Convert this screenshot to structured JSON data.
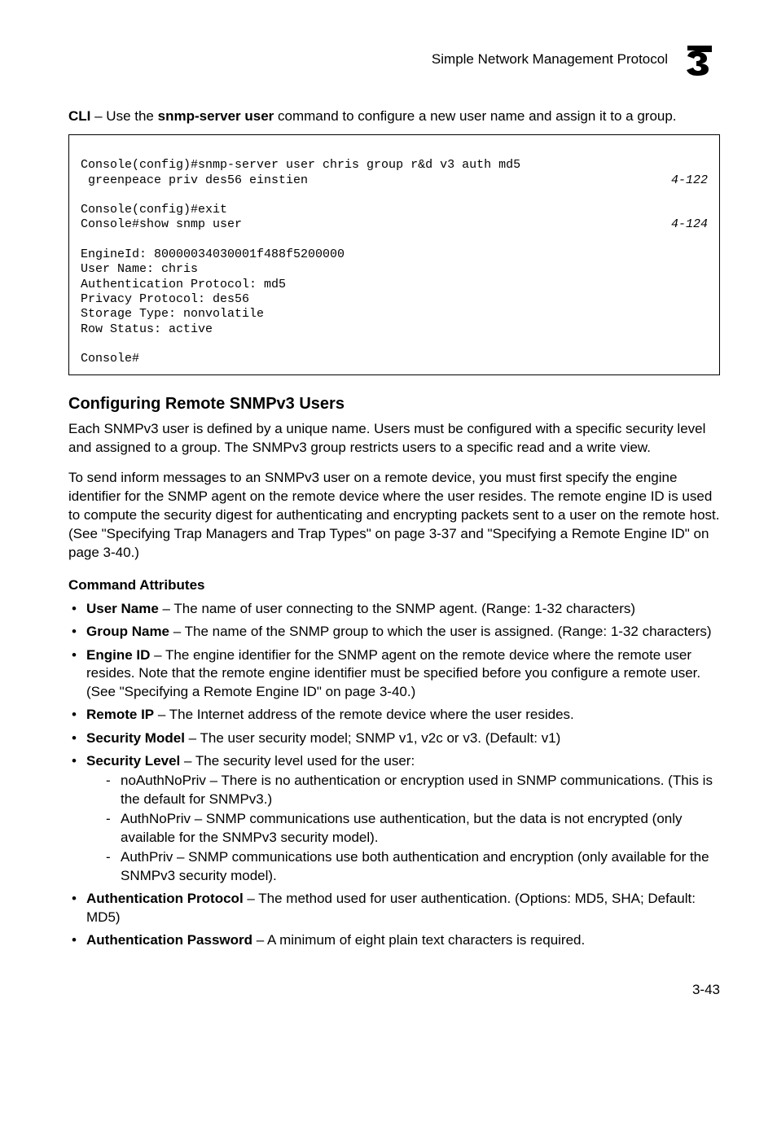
{
  "header": {
    "title": "Simple Network Management Protocol",
    "chapter": "3"
  },
  "intro": {
    "prefix": "CLI",
    "sep": " – Use the ",
    "cmd": "snmp-server user",
    "rest": " command to configure a new user name and assign it to a group."
  },
  "code": {
    "l1": "Console(config)#snmp-server user chris group r&d v3 auth md5",
    "l2": " greenpeace priv des56 einstien",
    "ref1": "4-122",
    "l3": "Console(config)#exit",
    "l4": "Console#show snmp user",
    "ref2": "4-124",
    "l5": "EngineId: 80000034030001f488f5200000",
    "l6": "User Name: chris",
    "l7": "Authentication Protocol: md5",
    "l8": "Privacy Protocol: des56",
    "l9": "Storage Type: nonvolatile",
    "l10": "Row Status: active",
    "l11": "",
    "l12": "Console#"
  },
  "section": {
    "title": "Configuring Remote SNMPv3 Users",
    "p1": "Each SNMPv3 user is defined by a unique name. Users must be configured with a specific security level and assigned to a group. The SNMPv3 group restricts users to a specific read and a write view.",
    "p2": "To send inform messages to an SNMPv3 user on a remote device, you must first specify the engine identifier for the SNMP agent on the remote device where the user resides. The remote engine ID is used to compute the security digest for authenticating and encrypting packets sent to a user on the remote host. (See \"Specifying Trap Managers and Trap Types\" on page 3-37 and \"Specifying a Remote Engine ID\" on page 3-40.)"
  },
  "attrs": {
    "heading": "Command Attributes",
    "items": [
      {
        "label": "User Name",
        "text": " – The name of user connecting to the SNMP agent. (Range: 1-32 characters)"
      },
      {
        "label": "Group Name",
        "text": " – The name of the SNMP group to which the user is assigned. (Range: 1-32 characters)"
      },
      {
        "label": "Engine ID",
        "text": " – The engine identifier for the SNMP agent on the remote device where the remote user resides. Note that the remote engine identifier must be specified before you configure a remote user. (See \"Specifying a Remote Engine ID\" on page 3-40.)"
      },
      {
        "label": "Remote IP",
        "text": " – The Internet address of the remote device where the user resides."
      },
      {
        "label": "Security Model",
        "text": " – The user security model; SNMP v1, v2c or v3. (Default: v1)"
      },
      {
        "label": "Security Level",
        "text": " – The security level used for the user:"
      },
      {
        "label": "Authentication Protocol",
        "text": " – The method used for user authentication. (Options: MD5,  SHA; Default: MD5)"
      },
      {
        "label": "Authentication Password",
        "text": " – A minimum of eight plain text characters is required."
      }
    ],
    "sub": [
      "noAuthNoPriv – There is no authentication or encryption used in SNMP communications. (This is the default for SNMPv3.)",
      "AuthNoPriv – SNMP communications use authentication, but the data is not encrypted (only available for the SNMPv3 security model).",
      "AuthPriv – SNMP communications use both authentication and encryption (only available for the SNMPv3 security model)."
    ]
  },
  "footer": {
    "page": "3-43"
  }
}
